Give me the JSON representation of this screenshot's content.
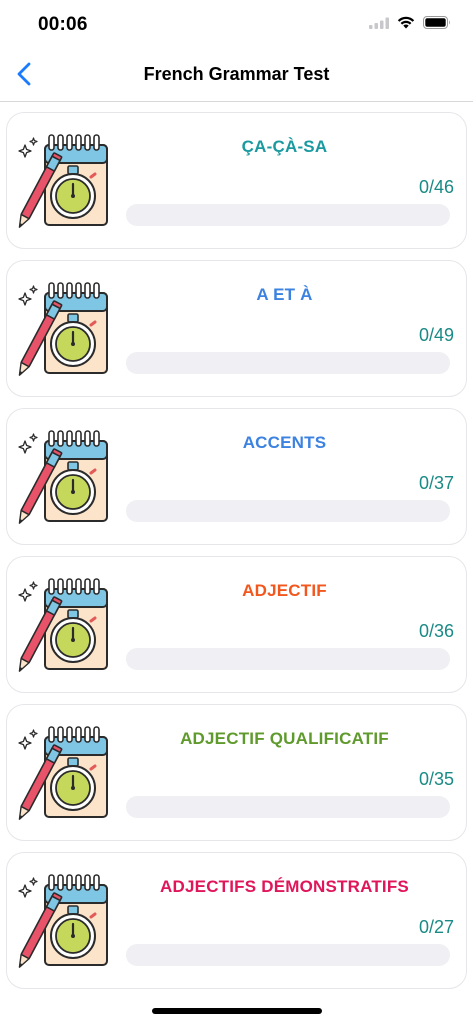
{
  "status_bar": {
    "time": "00:06"
  },
  "nav": {
    "title": "French Grammar Test",
    "back_icon": "chevron-left-icon"
  },
  "colors": {
    "accent_blue": "#1a7bff",
    "progress_text": "#1a8a86",
    "track": "#efeff4"
  },
  "tests": [
    {
      "title": "ÇA-ÇÀ-SA",
      "progress": "0/46",
      "completed": 0,
      "total": 46,
      "color": "#1a9aa0"
    },
    {
      "title": "A ET À",
      "progress": "0/49",
      "completed": 0,
      "total": 49,
      "color": "#3c82e0"
    },
    {
      "title": "ACCENTS",
      "progress": "0/37",
      "completed": 0,
      "total": 37,
      "color": "#3c82e0"
    },
    {
      "title": "ADJECTIF",
      "progress": "0/36",
      "completed": 0,
      "total": 36,
      "color": "#f2571e"
    },
    {
      "title": "ADJECTIF QUALIFICATIF",
      "progress": "0/35",
      "completed": 0,
      "total": 35,
      "color": "#5f9a2c"
    },
    {
      "title": "ADJECTIFS DÉMONSTRATIFS",
      "progress": "0/27",
      "completed": 0,
      "total": 27,
      "color": "#e0165a"
    }
  ]
}
